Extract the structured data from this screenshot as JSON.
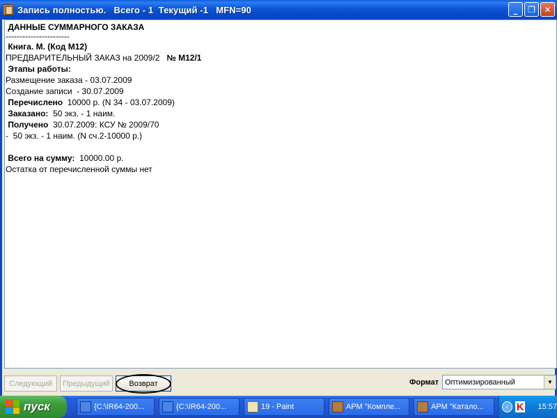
{
  "window": {
    "title": "Запись полностью.   Всего - 1  Текущий -1   MFN=90"
  },
  "document": {
    "header": "ДАННЫЕ СУММАРНОГО ЗАКАЗА",
    "separator": "-----------------------",
    "book": "Книга. М. (Код М12)",
    "preorder_prefix": "ПРЕДВАРИТЕЛЬНЫЙ ЗАКАЗ на 2009/2",
    "preorder_number": "№ М12/1",
    "stages_label": "Этапы работы:",
    "placement": "Размещение заказа - 03.07.2009",
    "creation": "Создание записи  - 30.07.2009",
    "transferred_label": "Перечислено",
    "transferred_value": "10000 р. (N 34 - 03.07.2009)",
    "ordered_label": "Заказано:",
    "ordered_value": "50 экз. - 1 наим.",
    "received_label": "Получено",
    "received_value": "30.07.2009: КСУ № 2009/70",
    "received_detail": "-  50 экз. - 1 наим. (N сч.2-10000 р.)",
    "total_label": "Всего на сумму:",
    "total_value": "10000.00 р.",
    "remainder": "Остатка от перечисленной суммы нет"
  },
  "toolbar": {
    "next_label": "Следующий",
    "prev_label": "Предыдущий",
    "back_label": "Возврат",
    "format_label": "Формат",
    "format_value": "Оптимизированный"
  },
  "taskbar": {
    "start_label": "пуск",
    "tasks": [
      {
        "label": "{C:\\IR64-200...",
        "icon": "folder-icon"
      },
      {
        "label": "{C:\\IR64-200...",
        "icon": "folder-icon"
      },
      {
        "label": "19 - Paint",
        "icon": "paint-icon"
      },
      {
        "label": "АРМ \"Компле...",
        "icon": "arm-icon"
      },
      {
        "label": "АРМ \"Катало...",
        "icon": "arm-icon"
      }
    ],
    "clock": "15:57"
  },
  "colors": {
    "titlebar": "#0a48c8",
    "taskbar": "#245edb",
    "start": "#3a9a3a"
  }
}
